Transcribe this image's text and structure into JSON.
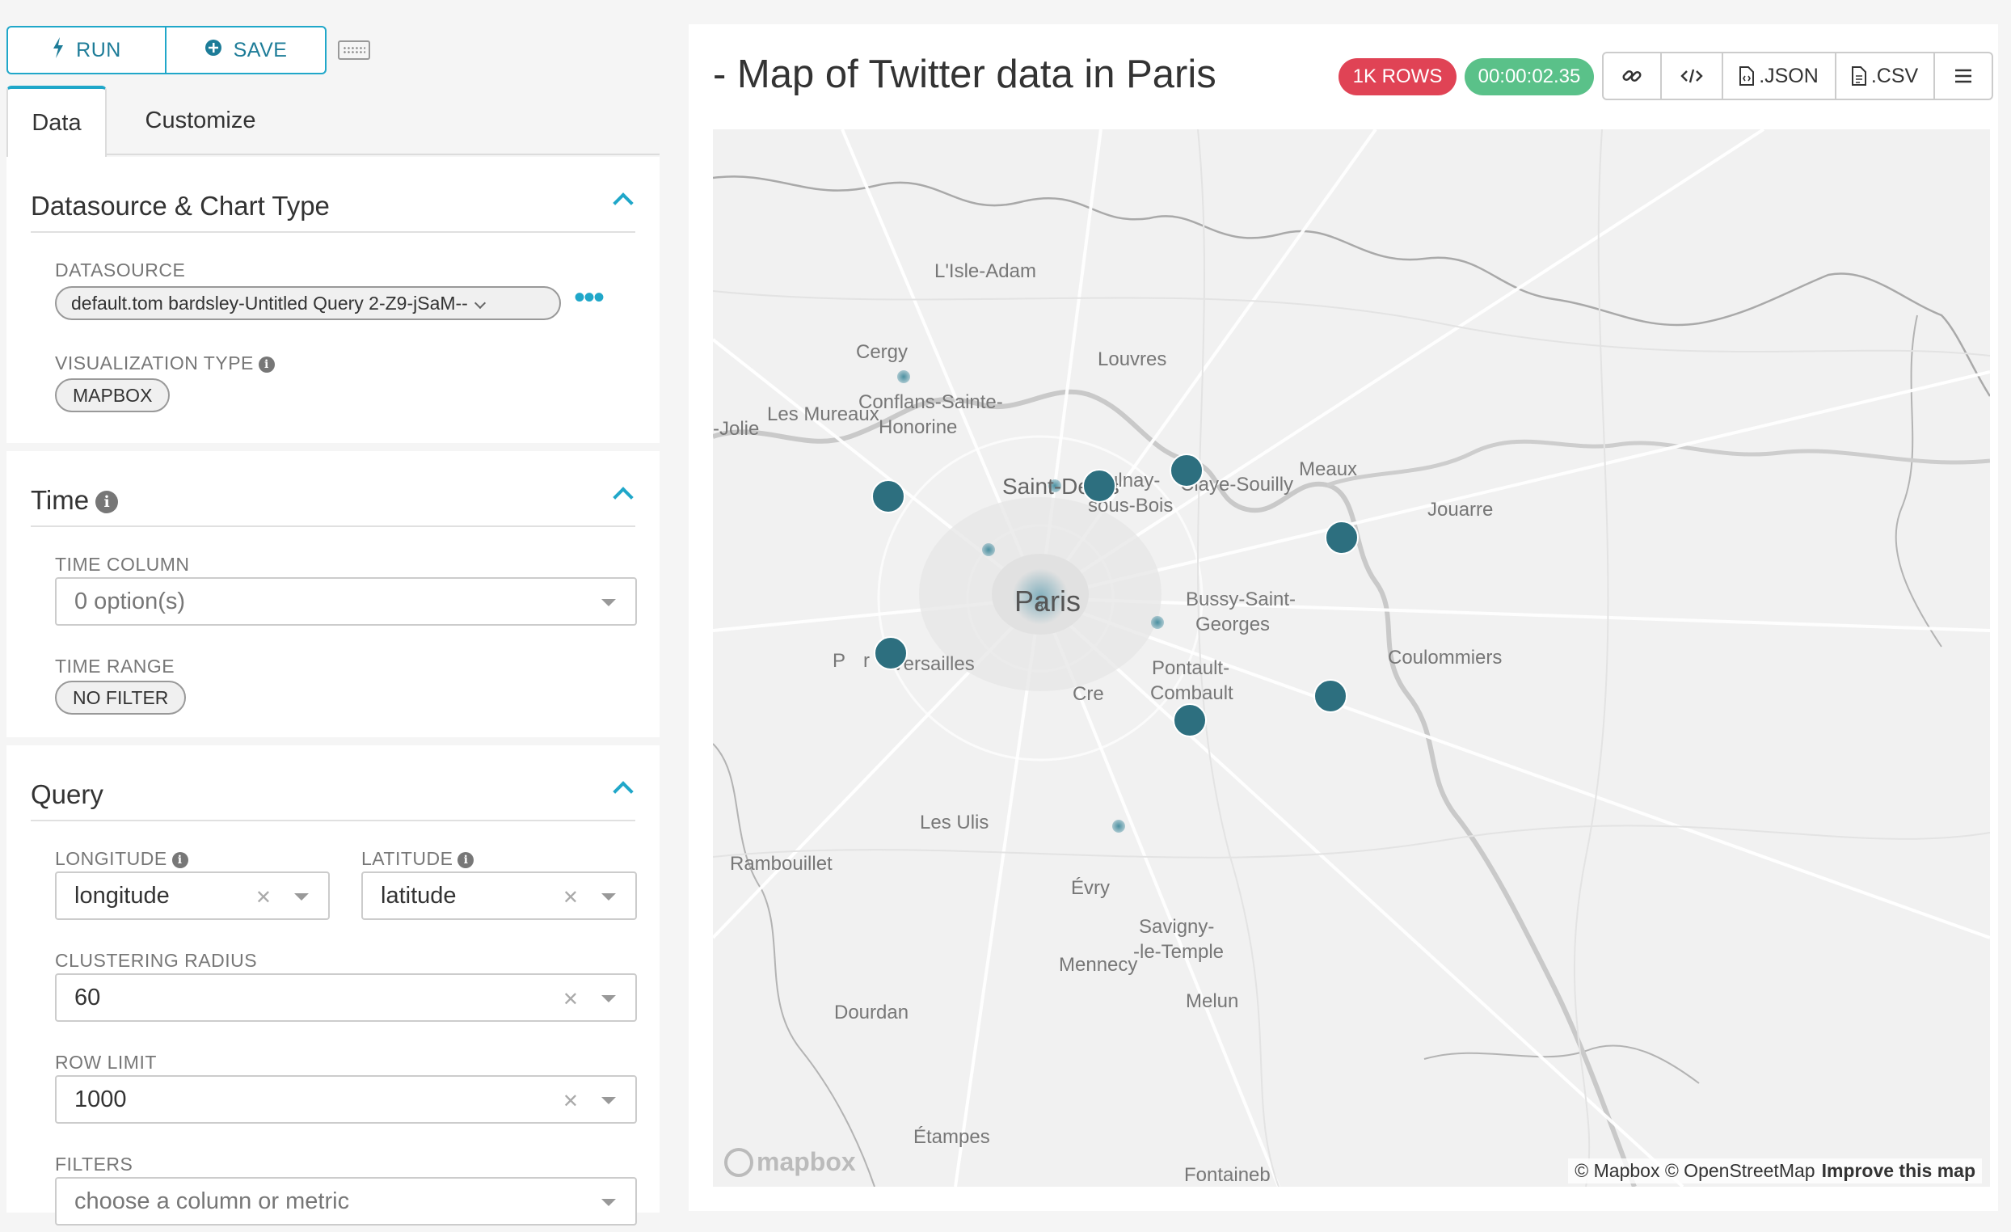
{
  "toolbar": {
    "run_label": "RUN",
    "save_label": "SAVE"
  },
  "tabs": [
    {
      "label": "Data"
    },
    {
      "label": "Customize"
    }
  ],
  "datasource_section": {
    "title": "Datasource & Chart Type",
    "datasource_label": "DATASOURCE",
    "datasource_value": "default.tom bardsley-Untitled Query 2-Z9-jSaM--",
    "viz_label": "VISUALIZATION TYPE",
    "viz_value": "MAPBOX"
  },
  "time_section": {
    "title": "Time",
    "time_column_label": "TIME COLUMN",
    "time_column_placeholder": "0 option(s)",
    "time_range_label": "TIME RANGE",
    "time_range_value": "NO FILTER"
  },
  "query_section": {
    "title": "Query",
    "longitude_label": "LONGITUDE",
    "longitude_value": "longitude",
    "latitude_label": "LATITUDE",
    "latitude_value": "latitude",
    "clustering_label": "CLUSTERING RADIUS",
    "clustering_value": "60",
    "row_limit_label": "ROW LIMIT",
    "row_limit_value": "1000",
    "filters_label": "FILTERS",
    "filters_placeholder": "choose a column or metric"
  },
  "chart": {
    "title": "- Map of Twitter data in Paris",
    "rows_badge": "1K ROWS",
    "timer_badge": "00:00:02.35",
    "json_label": ".JSON",
    "csv_label": ".CSV"
  },
  "map": {
    "places": [
      "L'Isle-Adam",
      "Cergy",
      "Louvres",
      "Conflans-Sainte-",
      "Honorine",
      "-Jolie",
      "Les Mureaux",
      "Saint-Denis",
      "Aulnay-",
      "sous-Bois",
      "Claye-Souilly",
      "Meaux",
      "Jouarre",
      "Paris",
      "Bussy-Saint-",
      "Georges",
      "Versailles",
      "Pontault-",
      "Combault",
      "Coulommiers",
      "Les Ulis",
      "Rambouillet",
      "Évry",
      "Savigny-",
      "-le-Temple",
      "Mennecy",
      "Melun",
      "Dourdan",
      "Étampes",
      "Fontaineb"
    ],
    "partial_labels": [
      "P",
      "r",
      "Cre",
      "a",
      "s"
    ],
    "cluster_count": "8",
    "logo_text": "mapbox",
    "attribution": "© Mapbox © OpenStreetMap",
    "improve_link": "Improve this map",
    "point_color": "#2d6f7f"
  },
  "colors": {
    "accent": "#20a7c9",
    "danger": "#e04355",
    "success": "#5ac189"
  }
}
